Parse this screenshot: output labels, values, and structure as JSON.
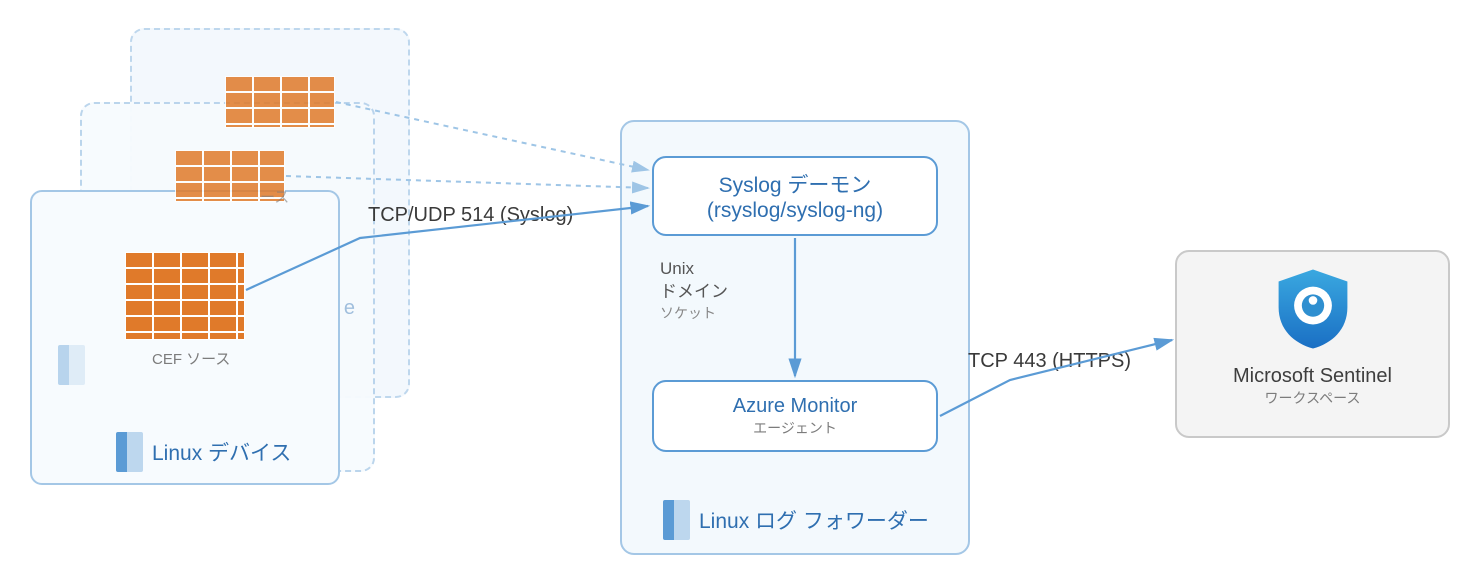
{
  "devices": {
    "cef_label": "CEF ソース",
    "cef_label_ghost": "ース",
    "footer": "Linux デバイス",
    "ghost_text": "e"
  },
  "forwarder": {
    "syslog_line1": "Syslog デーモン",
    "syslog_line2": "(rsyslog/syslog-ng)",
    "unix_line1": "Unix",
    "unix_line2": "ドメイン",
    "unix_line3": "ソケット",
    "amon_title": "Azure Monitor",
    "amon_sub": "エージェント",
    "footer": "Linux ログ フォワーダー"
  },
  "sentinel": {
    "title": "Microsoft Sentinel",
    "sub": "ワークスペース"
  },
  "connections": {
    "syslog": "TCP/UDP 514 (Syslog)",
    "https": "TCP 443 (HTTPS)"
  }
}
